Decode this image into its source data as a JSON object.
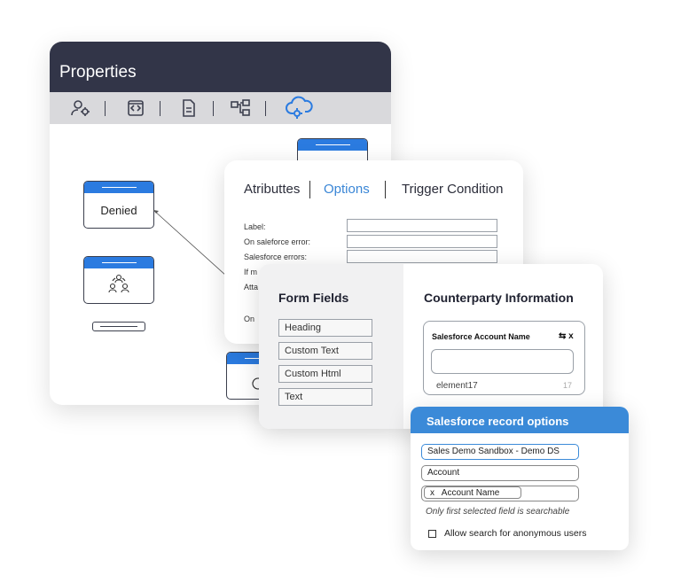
{
  "properties": {
    "title": "Properties",
    "toolbar_icons": [
      "user-settings-icon",
      "code-icon",
      "document-icon",
      "workflow-icon",
      "cloud-settings-icon"
    ],
    "nodes": {
      "denied": "Denied"
    }
  },
  "attributes": {
    "tabs": [
      "Atributtes",
      "Options",
      "Trigger Condition"
    ],
    "active_tab": "Options",
    "fields": [
      "Label:",
      "On saleforce error:",
      "Salesforce errors:",
      "If m",
      "Atta",
      "On"
    ]
  },
  "form_fields": {
    "title": "Form Fields",
    "items": [
      "Heading",
      "Custom Text",
      "Custom Html",
      "Text"
    ]
  },
  "counterparty": {
    "title": "Counterparty Information",
    "field_label": "Salesforce Account Name",
    "field_icon": "⇆ x",
    "element_name": "element17",
    "element_count": "17"
  },
  "record_options": {
    "title": "Salesforce record options",
    "source": "Sales Demo Sandbox - Demo DS",
    "object": "Account",
    "selected_field": "Account Name",
    "remove_label": "x",
    "hint": "Only first selected field is searchable",
    "checkbox_label": "Allow search for anonymous users"
  },
  "colors": {
    "header_dark": "#323548",
    "accent_blue": "#2b7be0",
    "option_blue": "#3a86d6"
  }
}
